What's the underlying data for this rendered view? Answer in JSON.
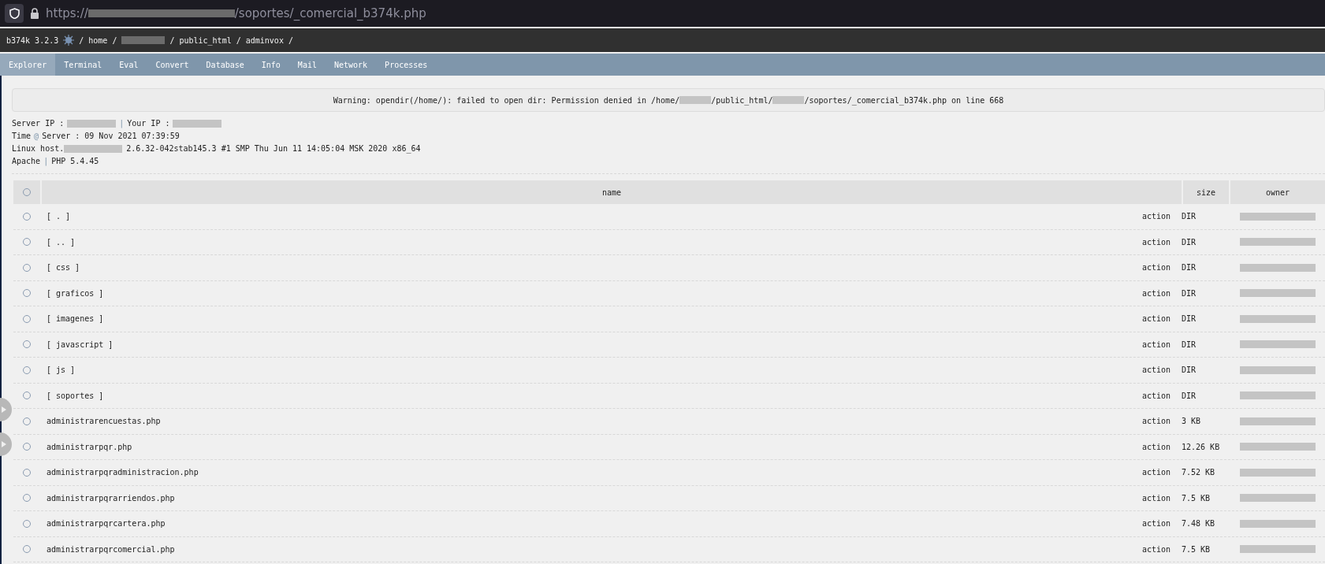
{
  "address_bar": {
    "url_start": "https://",
    "url_end": "/soportes/_comercial_b374k.php"
  },
  "header": {
    "app": "b374k 3.2.3",
    "path": [
      {
        "text": "/ home /"
      },
      {
        "text": "/ public_html / adminvox /"
      }
    ]
  },
  "tabs": [
    {
      "label": "Explorer",
      "selected": true
    },
    {
      "label": "Terminal",
      "selected": false
    },
    {
      "label": "Eval",
      "selected": false
    },
    {
      "label": "Convert",
      "selected": false
    },
    {
      "label": "Database",
      "selected": false
    },
    {
      "label": "Info",
      "selected": false
    },
    {
      "label": "Mail",
      "selected": false
    },
    {
      "label": "Network",
      "selected": false
    },
    {
      "label": "Processes",
      "selected": false
    }
  ],
  "warning": {
    "parts": [
      "Warning: opendir(/home/): failed to open dir: Permission denied in /home/",
      "/public_html/",
      "/soportes/_comercial_b374k.php on line 668"
    ]
  },
  "info": {
    "server_ip": "Server IP :",
    "separator_1": "|",
    "your_ip": "Your IP :",
    "time_label": "Time",
    "at": "@",
    "time_value": "Server : 09 Nov 2021 07:39:59",
    "linux_start": "Linux host.",
    "linux_end": "2.6.32-042stab145.3 #1 SMP Thu Jun 11 14:05:04 MSK 2020 x86_64",
    "server": "Apache",
    "separator_2": "|",
    "php": "PHP 5.4.45"
  },
  "table": {
    "columns": [
      "name",
      "size",
      "owner"
    ],
    "select_all_checked": false,
    "rows": [
      {
        "name": "[ . ]",
        "action": "action",
        "size": "DIR",
        "checked": false
      },
      {
        "name": "[ .. ]",
        "action": "action",
        "size": "DIR",
        "checked": false
      },
      {
        "name": "[ css ]",
        "action": "action",
        "size": "DIR",
        "checked": false
      },
      {
        "name": "[ graficos ]",
        "action": "action",
        "size": "DIR",
        "checked": false
      },
      {
        "name": "[ imagenes ]",
        "action": "action",
        "size": "DIR",
        "checked": false
      },
      {
        "name": "[ javascript ]",
        "action": "action",
        "size": "DIR",
        "checked": false
      },
      {
        "name": "[ js ]",
        "action": "action",
        "size": "DIR",
        "checked": false
      },
      {
        "name": "[ soportes ]",
        "action": "action",
        "size": "DIR",
        "checked": false
      },
      {
        "name": "administrarencuestas.php",
        "action": "action",
        "size": "3 KB",
        "checked": false
      },
      {
        "name": "administrarpqr.php",
        "action": "action",
        "size": "12.26 KB",
        "checked": false
      },
      {
        "name": "administrarpqradministracion.php",
        "action": "action",
        "size": "7.52 KB",
        "checked": false
      },
      {
        "name": "administrarpqrarriendos.php",
        "action": "action",
        "size": "7.5 KB",
        "checked": false
      },
      {
        "name": "administrarpqrcartera.php",
        "action": "action",
        "size": "7.48 KB",
        "checked": false
      },
      {
        "name": "administrarpqrcomercial.php",
        "action": "action",
        "size": "7.5 KB",
        "checked": false
      }
    ]
  }
}
